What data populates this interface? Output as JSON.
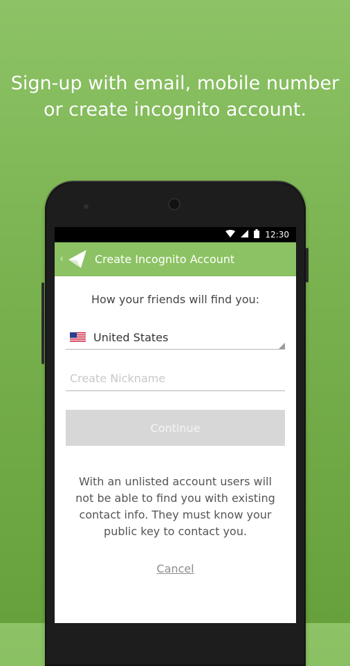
{
  "headline": {
    "line1": "Sign-up with email, mobile number",
    "line2": "or create incognito account."
  },
  "status_bar": {
    "time": "12:30",
    "icons": [
      "wifi-icon",
      "signal-icon",
      "battery-icon"
    ]
  },
  "app_bar": {
    "title": "Create Incognito Account",
    "back_icon": "chevron-left-icon",
    "logo_icon": "paper-plane-logo"
  },
  "form": {
    "subtitle": "How your friends will find you:",
    "country": {
      "flag_icon": "us-flag-icon",
      "selected": "United States"
    },
    "nickname": {
      "value": "",
      "placeholder": "Create Nickname"
    },
    "continue_label": "Continue",
    "info_text": "With an unlisted account users will not be able to find you with existing contact info. They must know your public key to contact you.",
    "cancel_label": "Cancel"
  },
  "colors": {
    "background_top": "#8dc366",
    "background_bottom": "#66a13b",
    "app_bar": "#8cc263",
    "continue_disabled": "#d7d7d7"
  }
}
